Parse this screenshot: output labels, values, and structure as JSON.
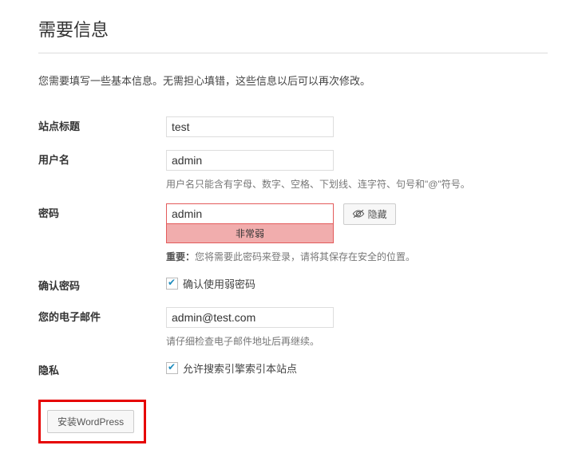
{
  "title": "需要信息",
  "intro": "您需要填写一些基本信息。无需担心填错，这些信息以后可以再次修改。",
  "fields": {
    "site_title": {
      "label": "站点标题",
      "value": "test"
    },
    "username": {
      "label": "用户名",
      "value": "admin",
      "hint": "用户名只能含有字母、数字、空格、下划线、连字符、句号和\"@\"符号。"
    },
    "password": {
      "label": "密码",
      "value": "admin",
      "strength": "非常弱",
      "hide_button": "隐藏",
      "hint_strong": "重要：",
      "hint_rest": "您将需要此密码来登录，请将其保存在安全的位置。"
    },
    "confirm_weak": {
      "label": "确认密码",
      "checkbox_label": "确认使用弱密码"
    },
    "email": {
      "label": "您的电子邮件",
      "value": "admin@test.com",
      "hint": "请仔细检查电子邮件地址后再继续。"
    },
    "privacy": {
      "label": "隐私",
      "checkbox_label": "允许搜索引擎索引本站点"
    }
  },
  "submit": {
    "install_label": "安装WordPress"
  }
}
